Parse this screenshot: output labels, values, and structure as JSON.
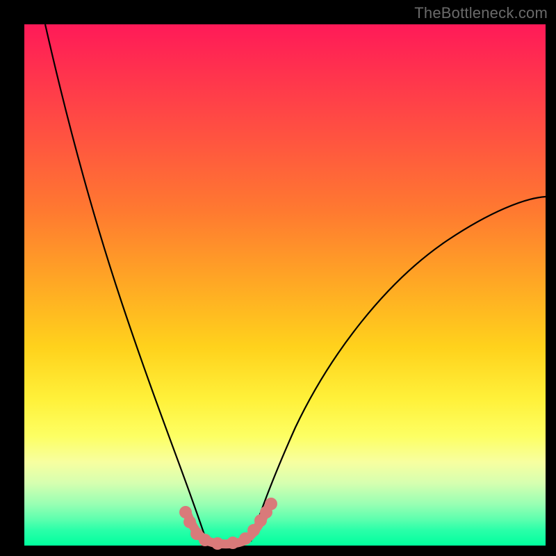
{
  "watermark": "TheBottleneck.com",
  "chart_data": {
    "type": "line",
    "title": "",
    "xlabel": "",
    "ylabel": "",
    "xlim": [
      0,
      100
    ],
    "ylim": [
      0,
      100
    ],
    "grid": false,
    "legend": false,
    "background_gradient": [
      "#ff1a58",
      "#ff7a30",
      "#ffd21c",
      "#fdff63",
      "#00ff9e"
    ],
    "series": [
      {
        "name": "left-curve",
        "stroke": "#000000",
        "x": [
          4,
          8,
          12,
          16,
          20,
          24,
          28,
          30,
          32,
          33,
          34
        ],
        "y": [
          100,
          78,
          58,
          42,
          29,
          18,
          10,
          6,
          3,
          1.5,
          0.5
        ]
      },
      {
        "name": "right-curve",
        "stroke": "#000000",
        "x": [
          43,
          44,
          46,
          50,
          55,
          62,
          70,
          80,
          90,
          100
        ],
        "y": [
          0.5,
          2,
          6,
          14,
          24,
          36,
          46,
          55,
          62,
          67
        ]
      },
      {
        "name": "bottom-segment",
        "stroke": "#d97575",
        "x": [
          30.5,
          31.5,
          32.5,
          33.5,
          35,
          37,
          39,
          41,
          42.5,
          44,
          45.5,
          47
        ],
        "y": [
          6,
          4,
          2.5,
          1.5,
          0.8,
          0.5,
          0.5,
          0.8,
          1.5,
          3,
          5,
          7.5
        ]
      }
    ],
    "markers": [
      {
        "series": "bottom-segment",
        "x": 30.8,
        "y": 6.2,
        "r": 1.3
      },
      {
        "series": "bottom-segment",
        "x": 31.6,
        "y": 4.4,
        "r": 1.3
      },
      {
        "series": "bottom-segment",
        "x": 33.0,
        "y": 1.9,
        "r": 1.3
      },
      {
        "series": "bottom-segment",
        "x": 34.5,
        "y": 0.9,
        "r": 1.3
      },
      {
        "series": "bottom-segment",
        "x": 37.0,
        "y": 0.5,
        "r": 1.3
      },
      {
        "series": "bottom-segment",
        "x": 40.0,
        "y": 0.6,
        "r": 1.3
      },
      {
        "series": "bottom-segment",
        "x": 42.5,
        "y": 1.5,
        "r": 1.3
      },
      {
        "series": "bottom-segment",
        "x": 43.9,
        "y": 3.1,
        "r": 1.3
      },
      {
        "series": "bottom-segment",
        "x": 45.2,
        "y": 4.9,
        "r": 1.3
      },
      {
        "series": "bottom-segment",
        "x": 46.4,
        "y": 6.6,
        "r": 1.3
      },
      {
        "series": "bottom-segment",
        "x": 47.2,
        "y": 8.0,
        "r": 1.3
      }
    ]
  }
}
